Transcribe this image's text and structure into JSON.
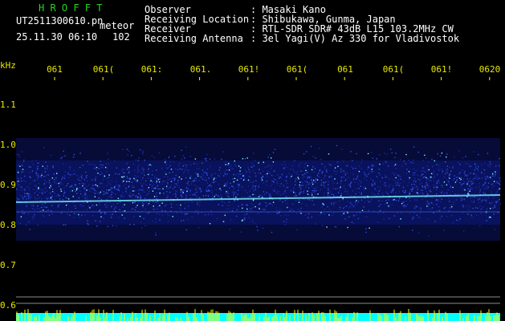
{
  "header": {
    "app_name": "H R O F F T",
    "filename": "UT2511300610.pn",
    "mode": "meteor",
    "datetime": "25.11.30 06:10",
    "count": "102",
    "fields": [
      {
        "label": "Observer",
        "value": ": Masaki Kano"
      },
      {
        "label": "Receiving Location",
        "value": ": Shibukawa, Gunma, Japan"
      },
      {
        "label": "Receiver",
        "value": ": RTL-SDR SDR# 43dB L15 103.2MHz CW"
      },
      {
        "label": "Receiving Antenna",
        "value": ": 3el Yagi(V) Az 330 for Vladivostok"
      }
    ]
  },
  "spectrogram": {
    "y_unit": "kHz",
    "y_ticks": [
      "1.1",
      "1.0",
      "0.9",
      "0.8",
      "0.7",
      "0.6"
    ],
    "x_ticks": [
      "061",
      "061(",
      "061:",
      "061.",
      "061!",
      "061(",
      "061",
      "061(",
      "061!",
      "0620"
    ],
    "colors": {
      "background": "#000000",
      "signal_low": "#1020a0",
      "signal_high": "#80ffff",
      "base_band": "#00ffff",
      "spikes": "#ffff00",
      "grid": "#ffffff"
    }
  }
}
